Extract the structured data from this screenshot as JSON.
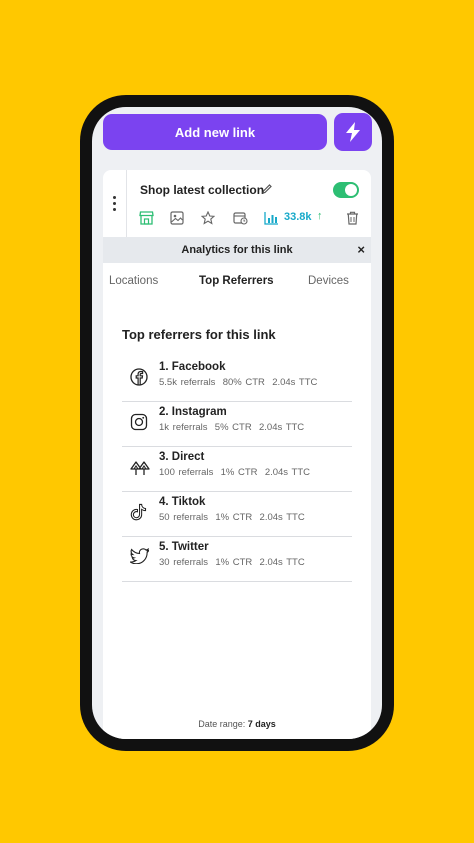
{
  "header": {
    "add_label": "Add new link"
  },
  "link": {
    "title": "Shop latest collection",
    "clicks": "33.8k",
    "trend": "↑",
    "toggle_on": true
  },
  "analytics": {
    "title": "Analytics for this link",
    "close": "×"
  },
  "tabs": [
    {
      "label": "Locations"
    },
    {
      "label": "Top Referrers"
    },
    {
      "label": "Devices"
    }
  ],
  "referrers": {
    "title": "Top referrers for this link",
    "items": [
      {
        "name": "1. Facebook",
        "referrals": "5.5k referrals",
        "ctr": "80% CTR",
        "ttc": "2.04s TTC",
        "icon": "facebook-icon"
      },
      {
        "name": "2. Instagram",
        "referrals": "1k referrals",
        "ctr": "5% CTR",
        "ttc": "2.04s TTC",
        "icon": "instagram-icon"
      },
      {
        "name": "3. Direct",
        "referrals": "100 referrals",
        "ctr": "1% CTR",
        "ttc": "2.04s TTC",
        "icon": "linktree-icon"
      },
      {
        "name": "4. Tiktok",
        "referrals": "50 referrals",
        "ctr": "1% CTR",
        "ttc": "2.04s TTC",
        "icon": "tiktok-icon"
      },
      {
        "name": "5. Twitter",
        "referrals": "30 referrals",
        "ctr": "1% CTR",
        "ttc": "2.04s TTC",
        "icon": "twitter-icon"
      }
    ]
  },
  "footer": {
    "date_label": "Date range:",
    "date_value": "7 days"
  },
  "colors": {
    "background": "#FFC800",
    "accent": "#7B43F0",
    "toggle": "#2DBE73",
    "clicks": "#17A9C9"
  }
}
